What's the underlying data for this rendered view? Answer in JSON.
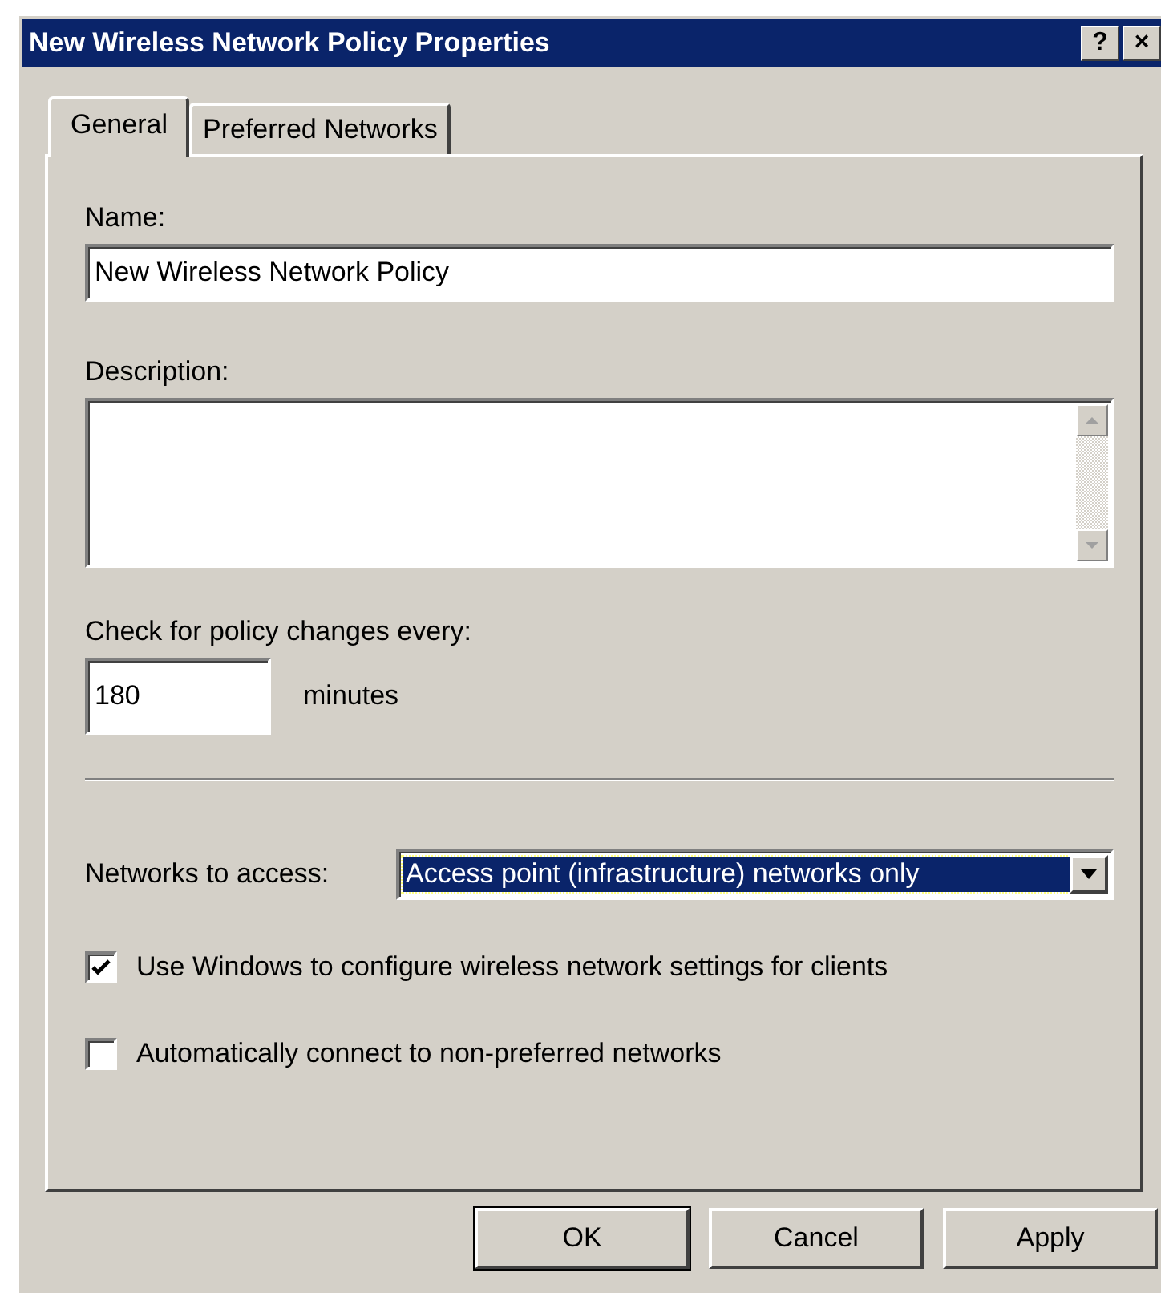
{
  "window": {
    "title": "New Wireless Network Policy Properties",
    "title_buttons": [
      "?",
      "×"
    ]
  },
  "tabs": [
    {
      "label": "General",
      "selected": true
    },
    {
      "label": "Preferred Networks",
      "selected": false
    }
  ],
  "name": {
    "label": "Name:",
    "value": "New Wireless Network Policy"
  },
  "description": {
    "label": "Description:"
  },
  "interval": {
    "label": "Check for policy changes every:",
    "value": "180",
    "unit": "minutes"
  },
  "networks_to_access": {
    "label": "Networks to access:",
    "value": "Access point (infrastructure) networks only",
    "focused": true
  },
  "checkboxes": [
    {
      "label": "Use Windows to configure wireless network settings for clients",
      "checked": true
    },
    {
      "label": "Automatically connect to non-preferred networks",
      "checked": false
    }
  ],
  "buttons": [
    {
      "label": "OK",
      "default": true
    },
    {
      "label": "Cancel",
      "default": false
    },
    {
      "label": "Apply",
      "default": false
    }
  ]
}
